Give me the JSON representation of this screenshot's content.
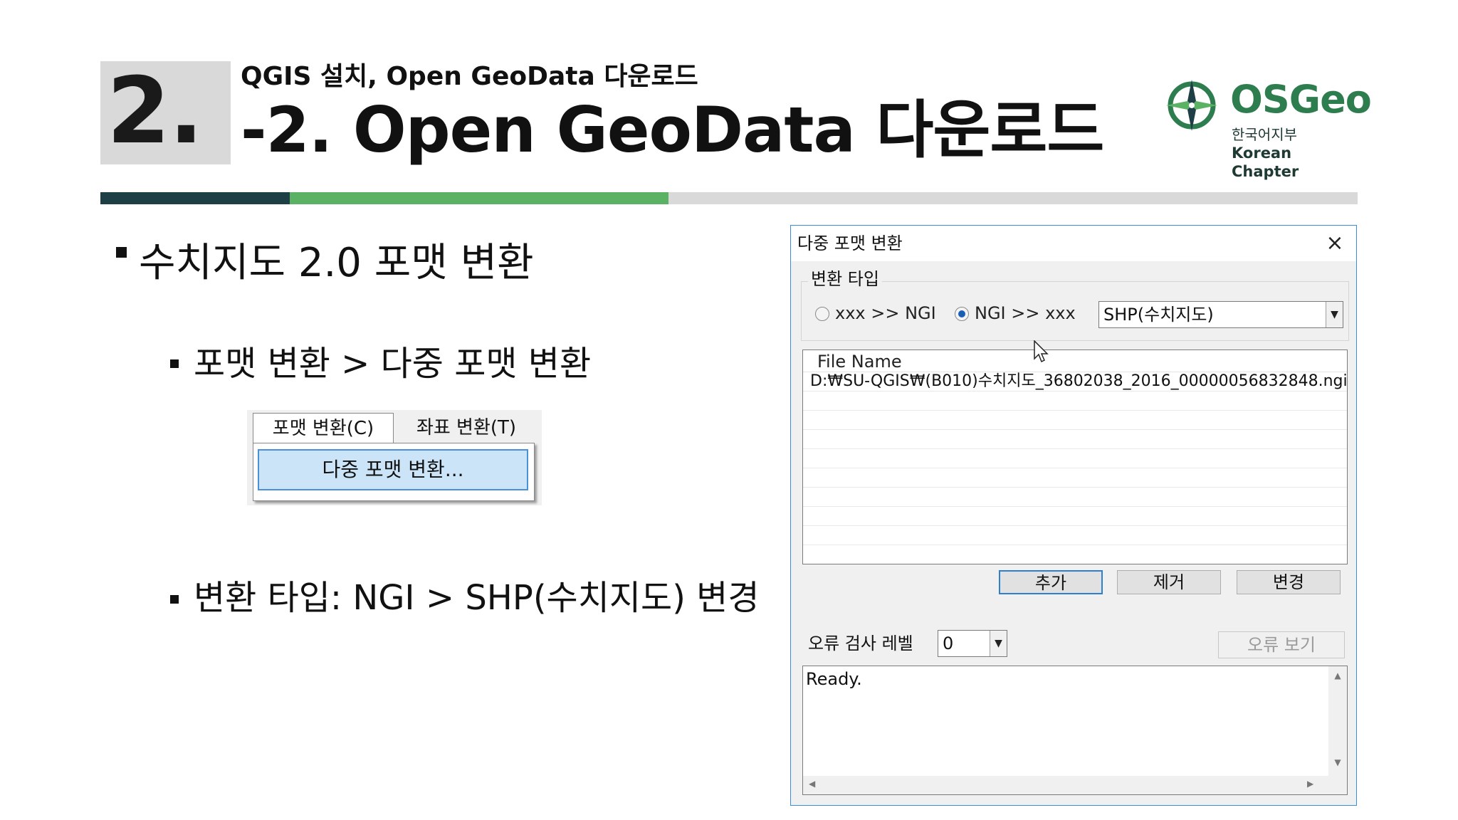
{
  "header": {
    "section_number": "2.",
    "subtitle": "QGIS 설치, Open GeoData 다운로드",
    "title": "-2. Open GeoData 다운로드"
  },
  "logo": {
    "name": "OSGeo",
    "sub1": "한국어지부",
    "sub2": "Korean Chapter",
    "color": "#2e7d4f"
  },
  "accent_colors": {
    "dark": "#1e3f45",
    "green": "#5cb264",
    "grey": "#d9d9d9"
  },
  "bullets": {
    "b1": "수치지도 2.0 포맷 변환",
    "b2": "포맷 변환 > 다중 포맷 변환",
    "b3": "변환 타입: NGI > SHP(수치지도) 변경"
  },
  "menu": {
    "tab_active": "포맷 변환(C)",
    "tab_other": "좌표 변환(T)",
    "item": "다중 포맷 변환..."
  },
  "dialog": {
    "title": "다중 포맷 변환",
    "close_icon": "×",
    "group_label": "변환 타입",
    "radio1": "xxx >> NGI",
    "radio2": "NGI >> xxx",
    "radio_selected": "NGI >> xxx",
    "format_select": "SHP(수치지도)",
    "list_header": "File Name",
    "files": [
      "D:₩SU-QGIS₩(B010)수치지도_36802038_2016_00000056832848.ngi"
    ],
    "btn_add": "추가",
    "btn_remove": "제거",
    "btn_change": "변경",
    "error_level_label": "오류 검사 레벨",
    "error_level_value": "0",
    "btn_view_errors": "오류 보기",
    "log_text": "Ready."
  }
}
